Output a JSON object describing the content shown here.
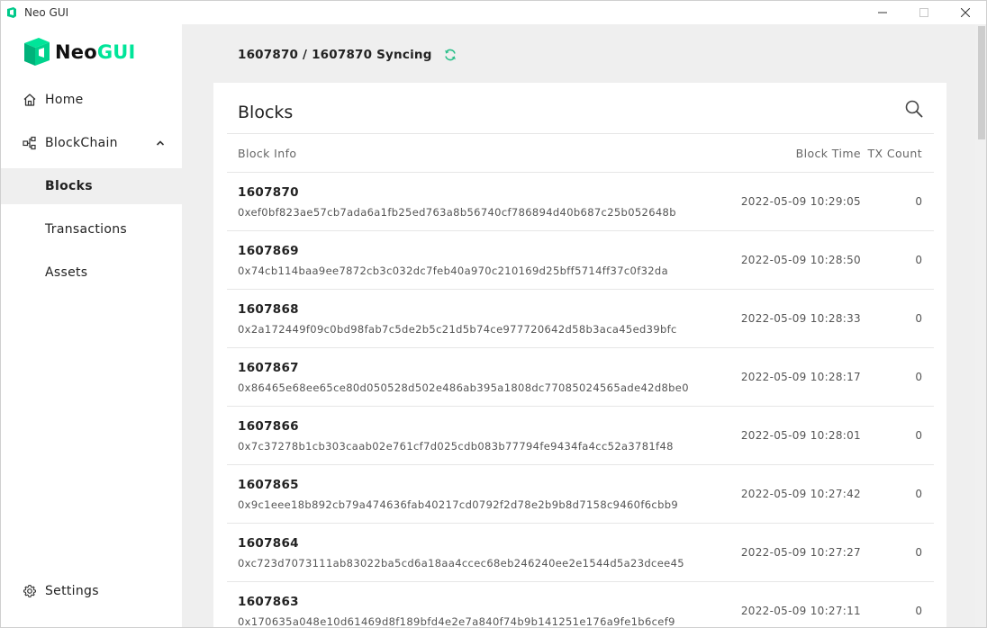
{
  "window": {
    "title": "Neo GUI"
  },
  "logo": {
    "part1": "Neo",
    "part2": "GUI"
  },
  "sidebar": {
    "items": [
      {
        "label": "Home",
        "icon": "home-icon"
      },
      {
        "label": "BlockChain",
        "icon": "blockchain-icon"
      },
      {
        "label": "Blocks"
      },
      {
        "label": "Transactions"
      },
      {
        "label": "Assets"
      }
    ],
    "settings_label": "Settings"
  },
  "status": {
    "sync_text": "1607870 / 1607870 Syncing"
  },
  "blocks": {
    "title": "Blocks",
    "columns": {
      "info": "Block Info",
      "time": "Block Time",
      "tx": "TX Count"
    },
    "rows": [
      {
        "index": "1607870",
        "hash": "0xef0bf823ae57cb7ada6a1fb25ed763a8b56740cf786894d40b687c25b052648b",
        "time": "2022-05-09 10:29:05",
        "tx": "0"
      },
      {
        "index": "1607869",
        "hash": "0x74cb114baa9ee7872cb3c032dc7feb40a970c210169d25bff5714ff37c0f32da",
        "time": "2022-05-09 10:28:50",
        "tx": "0"
      },
      {
        "index": "1607868",
        "hash": "0x2a172449f09c0bd98fab7c5de2b5c21d5b74ce977720642d58b3aca45ed39bfc",
        "time": "2022-05-09 10:28:33",
        "tx": "0"
      },
      {
        "index": "1607867",
        "hash": "0x86465e68ee65ce80d050528d502e486ab395a1808dc77085024565ade42d8be0",
        "time": "2022-05-09 10:28:17",
        "tx": "0"
      },
      {
        "index": "1607866",
        "hash": "0x7c37278b1cb303caab02e761cf7d025cdb083b77794fe9434fa4cc52a3781f48",
        "time": "2022-05-09 10:28:01",
        "tx": "0"
      },
      {
        "index": "1607865",
        "hash": "0x9c1eee18b892cb79a474636fab40217cd0792f2d78e2b9b8d7158c9460f6cbb9",
        "time": "2022-05-09 10:27:42",
        "tx": "0"
      },
      {
        "index": "1607864",
        "hash": "0xc723d7073111ab83022ba5cd6a18aa4ccec68eb246240ee2e1544d5a23dcee45",
        "time": "2022-05-09 10:27:27",
        "tx": "0"
      },
      {
        "index": "1607863",
        "hash": "0x170635a048e10d61469d8f189bfd4e2e7a840f74b9b141251e176a9fe1b6cef9",
        "time": "2022-05-09 10:27:11",
        "tx": "0"
      }
    ]
  },
  "colors": {
    "accent": "#00e599",
    "sync_icon": "#2bbf8a",
    "sidebar_active_bg": "#efefef",
    "main_bg": "#efefef"
  }
}
